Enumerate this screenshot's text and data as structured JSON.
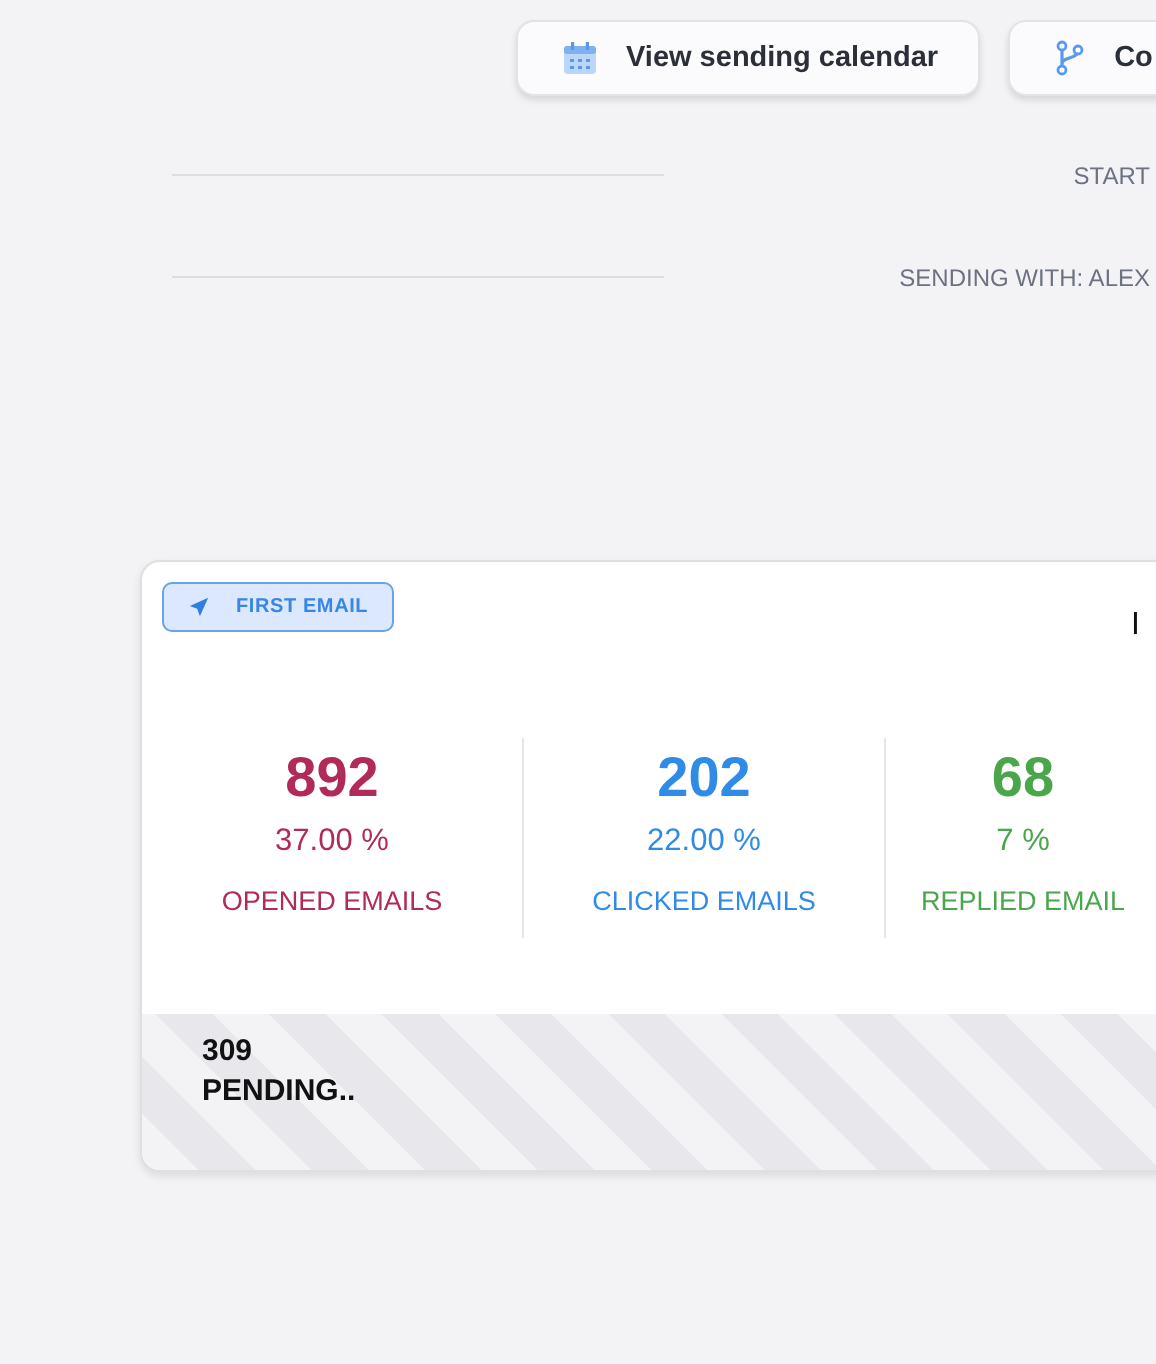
{
  "toolbar": {
    "buttons": [
      {
        "label": "View sending calendar",
        "kind": "calendar"
      },
      {
        "label": "Co",
        "kind": "branch"
      }
    ]
  },
  "info_rows": [
    {
      "label": "START"
    },
    {
      "label": "SENDING WITH: ALEX"
    }
  ],
  "step_card": {
    "badge": "FIRST EMAIL",
    "title": "I",
    "stats": [
      {
        "count": "892",
        "percent": "37.00 %",
        "label": "OPENED EMAILS",
        "color": "#b02a5a"
      },
      {
        "count": "202",
        "percent": "22.00 %",
        "label": "CLICKED EMAILS",
        "color": "#2f8be6"
      },
      {
        "count": "68",
        "percent": "7 %",
        "label": "REPLIED EMAIL",
        "color": "#4aa64a"
      }
    ],
    "pending": {
      "count": "309",
      "label": "PENDING.."
    }
  }
}
